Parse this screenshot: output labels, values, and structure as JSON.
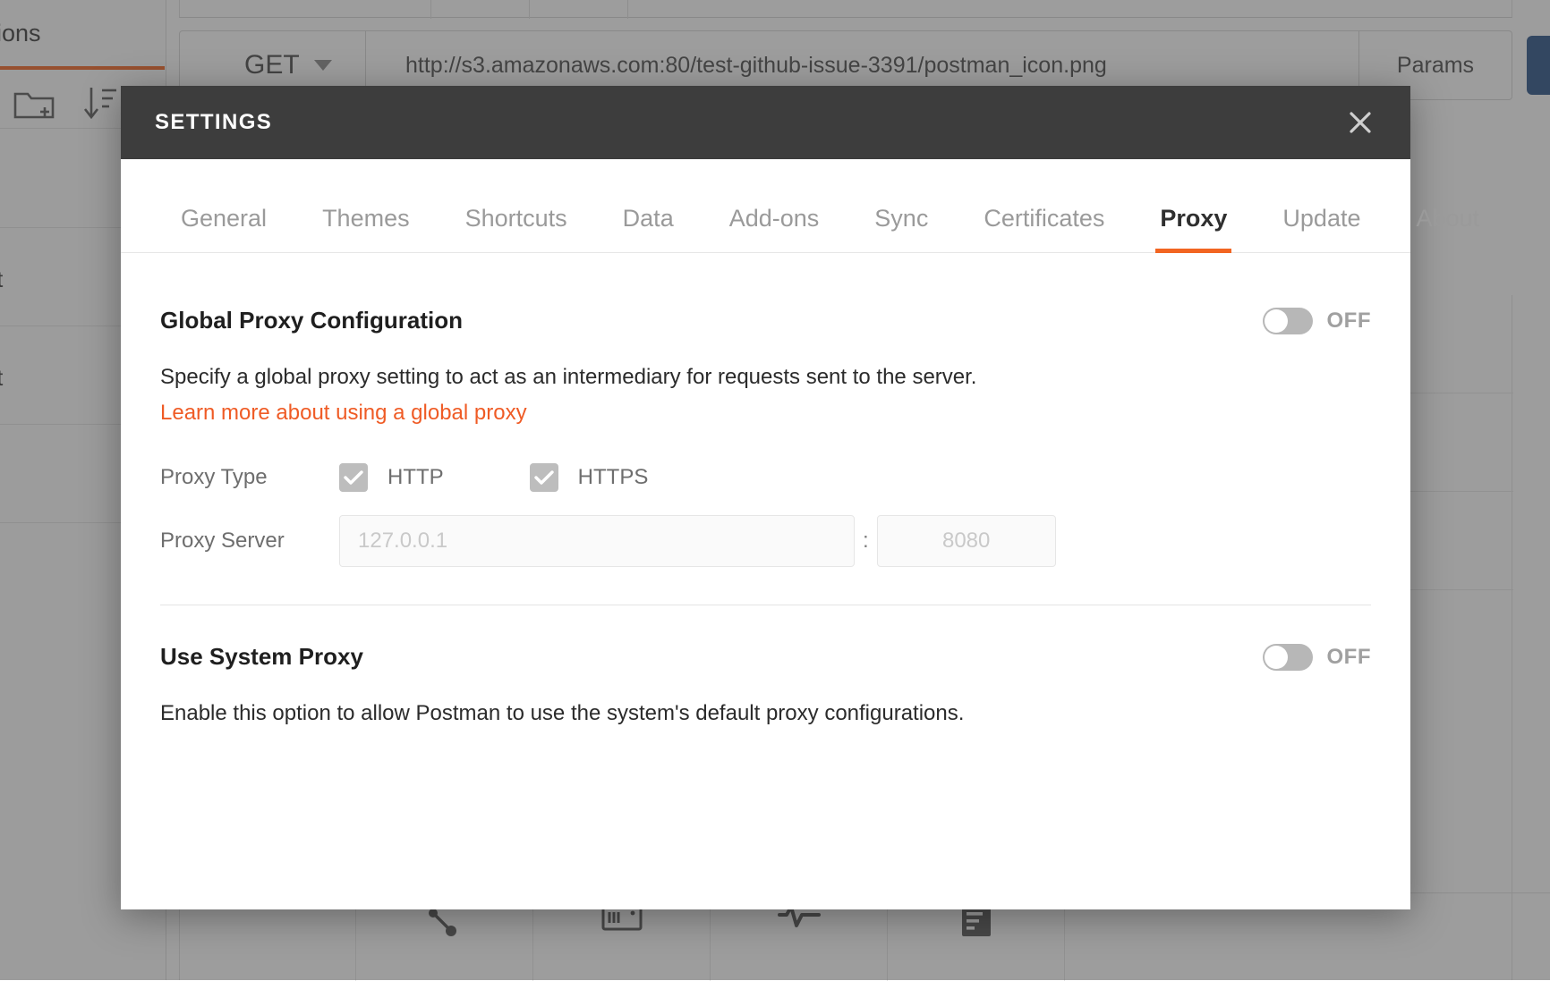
{
  "app": {
    "sidebar": {
      "tab_label": "llections",
      "new_folder_icon": "new-folder-icon",
      "sort_icon": "sort-descending-icon",
      "rows": [
        {
          "label": ""
        },
        {
          "label": "rt"
        },
        {
          "label": "rt"
        },
        {
          "label": ""
        }
      ]
    },
    "request_bar": {
      "method": "GET",
      "url": "http://s3.amazonaws.com:80/test-github-issue-3391/postman_icon.png",
      "params_label": "Params",
      "send_label": ""
    },
    "bottom_bar": {
      "icons": [
        "share-icon",
        "console-icon",
        "activity-monitor-icon",
        "documentation-icon"
      ]
    }
  },
  "modal": {
    "title": "SETTINGS",
    "close_icon": "close-icon",
    "tabs": [
      {
        "label": "General",
        "active": false
      },
      {
        "label": "Themes",
        "active": false
      },
      {
        "label": "Shortcuts",
        "active": false
      },
      {
        "label": "Data",
        "active": false
      },
      {
        "label": "Add-ons",
        "active": false
      },
      {
        "label": "Sync",
        "active": false
      },
      {
        "label": "Certificates",
        "active": false
      },
      {
        "label": "Proxy",
        "active": true
      },
      {
        "label": "Update",
        "active": false
      },
      {
        "label": "About",
        "active": false
      }
    ],
    "global_proxy": {
      "title": "Global Proxy Configuration",
      "toggle_state": "OFF",
      "description": "Specify a global proxy setting to act as an intermediary for requests sent to the server.",
      "link_text": "Learn more about using a global proxy",
      "proxy_type_label": "Proxy Type",
      "proxy_type_options": [
        {
          "label": "HTTP",
          "checked": true
        },
        {
          "label": "HTTPS",
          "checked": true
        }
      ],
      "proxy_server_label": "Proxy Server",
      "host_placeholder": "127.0.0.1",
      "host_value": "",
      "port_separator": ":",
      "port_placeholder": "8080",
      "port_value": ""
    },
    "system_proxy": {
      "title": "Use System Proxy",
      "toggle_state": "OFF",
      "description": "Enable this option to allow Postman to use the system's default proxy configurations."
    }
  },
  "colors": {
    "accent_orange": "#f26522",
    "link_orange": "#ef5b25",
    "header_dark": "#3d3d3d",
    "send_blue": "#2b5387"
  }
}
